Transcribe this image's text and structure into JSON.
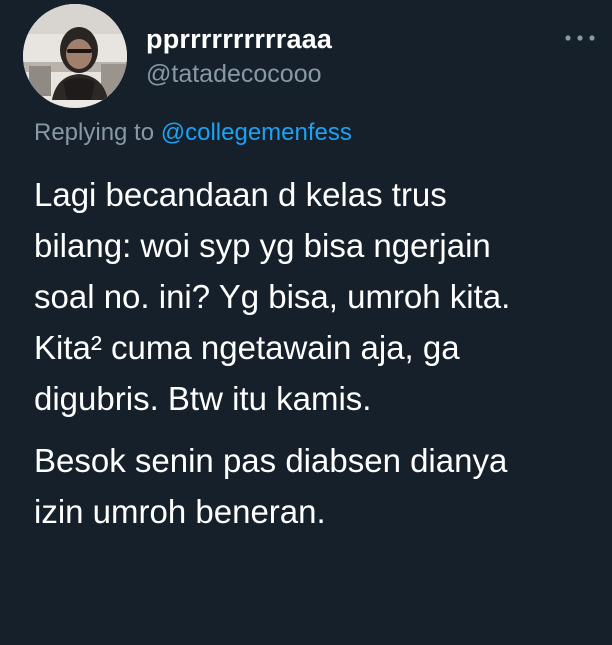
{
  "tweet": {
    "display_name": "pprrrrrrrrrraaa",
    "handle": "@tatadecocooo",
    "more_icon": "more-horizontal-icon",
    "reply": {
      "prefix": "Replying to",
      "mention": "@collegemenfess"
    },
    "body": {
      "paragraph1_lines": [
        "Lagi becandaan d kelas trus",
        "bilang: woi syp yg bisa ngerjain",
        "soal no. ini? Yg bisa, umroh kita.",
        "Kita² cuma ngetawain aja, ga",
        "digubris. Btw itu kamis."
      ],
      "paragraph2_lines": [
        "Besok senin pas diabsen dianya",
        "izin umroh beneran."
      ]
    }
  },
  "colors": {
    "background": "#15202b",
    "text_primary": "#ffffff",
    "text_secondary": "#8899a6",
    "link": "#1da1f2"
  }
}
